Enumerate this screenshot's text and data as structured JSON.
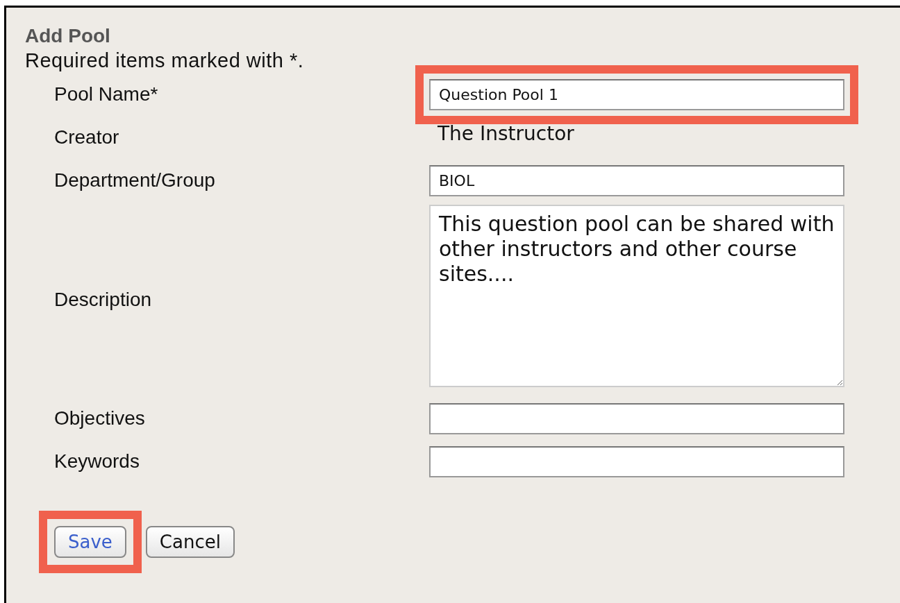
{
  "title": "Add Pool",
  "note": "Required items marked with *.",
  "fields": [
    {
      "kind": "text",
      "label": "Pool Name*",
      "value": "Question Pool 1",
      "highlighted": true
    },
    {
      "kind": "static",
      "label": "Creator",
      "value": "The Instructor"
    },
    {
      "kind": "text",
      "label": "Department/Group",
      "value": "BIOL",
      "highlighted": false
    },
    {
      "kind": "textarea",
      "label": "Description",
      "value": "This question pool can be shared with other instructors and other course sites....",
      "highlighted": false
    },
    {
      "kind": "text",
      "label": "Objectives",
      "highlighted": false
    },
    {
      "kind": "text",
      "label": "Keywords",
      "highlighted": false
    }
  ],
  "buttons": [
    {
      "label": "Save",
      "primary": true,
      "highlighted": true
    },
    {
      "label": "Cancel",
      "primary": false,
      "highlighted": false
    }
  ]
}
